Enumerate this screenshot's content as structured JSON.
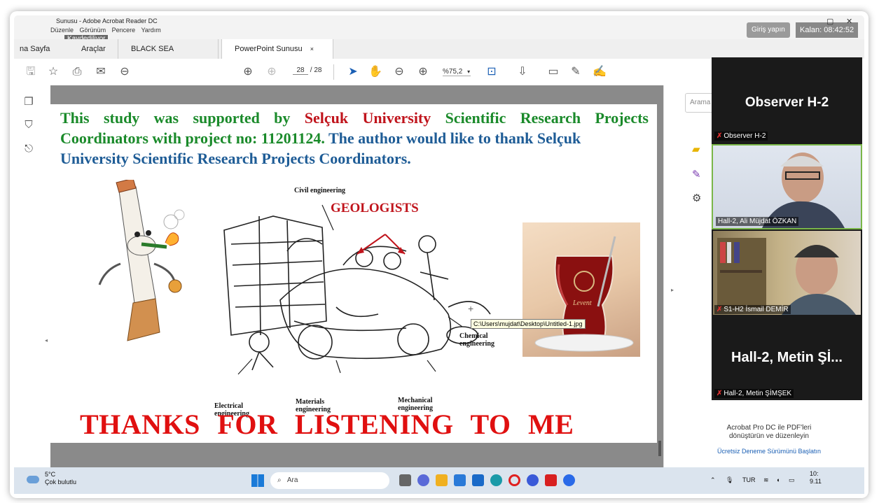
{
  "window": {
    "title": "Sunusu - Adobe Acrobat Reader DC",
    "saving": "Kaydediliyor",
    "menu": [
      "Düzenle",
      "Görünüm",
      "Pencere",
      "Yardım"
    ],
    "giris": "Giriş yapın",
    "kalan": "Kalan: 08:42:52"
  },
  "tabs": {
    "home": "na Sayfa",
    "tools": "Araçlar",
    "doc1": "BLACK SEA PROGR...",
    "doc2": "PowerPoint Sunusu",
    "close": "×"
  },
  "toolbar": {
    "page_current": "28",
    "page_total": "/ 28",
    "zoom": "%75,2"
  },
  "slide": {
    "line1_a": "This study was supported by",
    "line1_b": "Selçuk University",
    "line1_c": "Scientific Research Projects",
    "line2_a": "Coordinators with project no: 11201124.",
    "line2_b": "The author would like to thank Selçuk",
    "line3": "University Scientific Research Projects Coordinators.",
    "civil": "Civil engineering",
    "geologists": "GEOLOGISTS",
    "chemical": "Chemical engineering",
    "electrical": "Electrical engineering",
    "materials": "Materials engineering",
    "mechanical": "Mechanical engineering",
    "glass_text": "Levent",
    "thanks": "THANKS FOR LISTENING TO ME",
    "tooltip": "C:\\Users\\mujdat\\Desktop\\Untitled-1.jpg"
  },
  "rightpanel": {
    "search": "Arama",
    "promo_line1": "Acrobat Pro DC ile PDF'leri",
    "promo_line2": "dönüştürün ve düzenleyin",
    "promo_link": "Ücretsiz Deneme Sürümünü Başlatın"
  },
  "zoom": {
    "p1_big": "Observer H-2",
    "p1_name": "Observer H-2",
    "p2_name": "Hall-2, Ali Müjdat ÖZKAN",
    "p3_name": "S1-H2 İsmail DEMİR",
    "p4_big": "Hall-2, Metin Şİ...",
    "p4_name": "Hall-2, Metin ŞİMŞEK"
  },
  "taskbar": {
    "temp": "5°C",
    "weather": "Çok bulutlu",
    "search": "Ara",
    "lang": "TUR",
    "time": "10:",
    "date": "9.11"
  },
  "colors": {
    "green": "#1a8a2a",
    "red": "#c0141c",
    "blue": "#1e5c96",
    "thanks_red": "#e01010"
  }
}
